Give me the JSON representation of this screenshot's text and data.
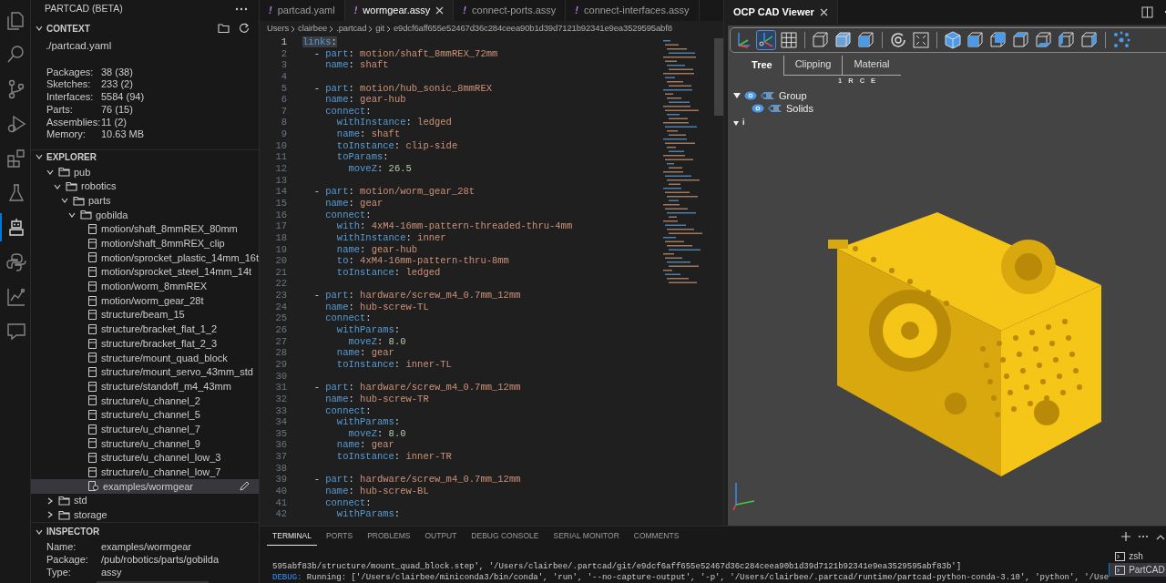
{
  "activity_bar": [
    {
      "kind": "files",
      "selected": false
    },
    {
      "kind": "search",
      "selected": false
    },
    {
      "kind": "source-control",
      "selected": false
    },
    {
      "kind": "run-debug",
      "selected": false
    },
    {
      "kind": "extensions",
      "selected": false
    },
    {
      "kind": "flask",
      "selected": false
    },
    {
      "kind": "robot",
      "selected": true
    },
    {
      "kind": "python",
      "selected": false
    },
    {
      "kind": "graph",
      "selected": false
    },
    {
      "kind": "comments",
      "selected": false
    }
  ],
  "sidebar": {
    "title": "PARTCAD (BETA)",
    "context": {
      "title": "CONTEXT",
      "expanded": true,
      "file": "./partcad.yaml",
      "stats": [
        {
          "label": "Packages:",
          "value": "38 (38)"
        },
        {
          "label": "Sketches:",
          "value": "233 (2)"
        },
        {
          "label": "Interfaces:",
          "value": "5584 (94)"
        },
        {
          "label": "Parts:",
          "value": "76 (15)"
        },
        {
          "label": "Assemblies:",
          "value": "11 (2)"
        },
        {
          "label": "Memory:",
          "value": "10.63 MB"
        }
      ]
    },
    "explorer": {
      "title": "EXPLORER",
      "expanded": true,
      "tree": [
        {
          "label": "pub",
          "kind": "folder",
          "expanded": true,
          "children": [
            {
              "label": "robotics",
              "kind": "folder",
              "expanded": true,
              "children": [
                {
                  "label": "parts",
                  "kind": "folder",
                  "expanded": true,
                  "children": [
                    {
                      "label": "gobilda",
                      "kind": "folder",
                      "expanded": true,
                      "children": [
                        {
                          "label": "motion/shaft_8mmREX_80mm",
                          "kind": "part",
                          "selected": false
                        },
                        {
                          "label": "motion/shaft_8mmREX_clip",
                          "kind": "part",
                          "selected": false
                        },
                        {
                          "label": "motion/sprocket_plastic_14mm_16t",
                          "kind": "part",
                          "selected": false
                        },
                        {
                          "label": "motion/sprocket_steel_14mm_14t",
                          "kind": "part",
                          "selected": false
                        },
                        {
                          "label": "motion/worm_8mmREX",
                          "kind": "part",
                          "selected": false
                        },
                        {
                          "label": "motion/worm_gear_28t",
                          "kind": "part",
                          "selected": false
                        },
                        {
                          "label": "structure/beam_15",
                          "kind": "part",
                          "selected": false
                        },
                        {
                          "label": "structure/bracket_flat_1_2",
                          "kind": "part",
                          "selected": false
                        },
                        {
                          "label": "structure/bracket_flat_2_3",
                          "kind": "part",
                          "selected": false
                        },
                        {
                          "label": "structure/mount_quad_block",
                          "kind": "part",
                          "selected": false
                        },
                        {
                          "label": "structure/mount_servo_43mm_std",
                          "kind": "part",
                          "selected": false
                        },
                        {
                          "label": "structure/standoff_m4_43mm",
                          "kind": "part",
                          "selected": false
                        },
                        {
                          "label": "structure/u_channel_2",
                          "kind": "part",
                          "selected": false
                        },
                        {
                          "label": "structure/u_channel_5",
                          "kind": "part",
                          "selected": false
                        },
                        {
                          "label": "structure/u_channel_7",
                          "kind": "part",
                          "selected": false
                        },
                        {
                          "label": "structure/u_channel_9",
                          "kind": "part",
                          "selected": false
                        },
                        {
                          "label": "structure/u_channel_low_3",
                          "kind": "part",
                          "selected": false
                        },
                        {
                          "label": "structure/u_channel_low_7",
                          "kind": "part",
                          "selected": false
                        },
                        {
                          "label": "examples/wormgear",
                          "kind": "assembly",
                          "selected": true
                        }
                      ]
                    }
                  ]
                }
              ]
            }
          ]
        },
        {
          "label": "std",
          "kind": "folder",
          "expanded": false
        },
        {
          "label": "storage",
          "kind": "folder",
          "expanded": false
        }
      ]
    },
    "inspector": {
      "title": "INSPECTOR",
      "expanded": true,
      "rows": [
        {
          "label": "Name:",
          "value": "examples/wormgear"
        },
        {
          "label": "Package:",
          "value": "/pub/robotics/parts/gobilda"
        },
        {
          "label": "Type:",
          "value": "assy"
        }
      ]
    }
  },
  "editor": {
    "tabs": [
      {
        "icon": "!",
        "label": "partcad.yaml",
        "selected": false
      },
      {
        "icon": "!",
        "label": "wormgear.assy",
        "selected": true
      },
      {
        "icon": "!",
        "label": "connect-ports.assy",
        "selected": false
      },
      {
        "icon": "!",
        "label": "connect-interfaces.assy",
        "selected": false
      }
    ],
    "breadcrumb": [
      "Users",
      "clairbee",
      ".partcad",
      "git",
      "e9dcf6aff655e52467d36c284ceea90b1d39d7121b92341e9ea3529595abf8"
    ],
    "lines": [
      {
        "n": "1",
        "text": "links:"
      },
      {
        "n": "2",
        "text": "  - part: motion/shaft_8mmREX_72mm"
      },
      {
        "n": "3",
        "text": "    name: shaft"
      },
      {
        "n": "4"
      },
      {
        "n": "5",
        "text": "  - part: motion/hub_sonic_8mmREX"
      },
      {
        "n": "6",
        "text": "    name: gear-hub"
      },
      {
        "n": "7",
        "text": "    connect:"
      },
      {
        "n": "8",
        "text": "      withInstance: ledged"
      },
      {
        "n": "9",
        "text": "      name: shaft"
      },
      {
        "n": "10",
        "text": "      toInstance: clip-side"
      },
      {
        "n": "11",
        "text": "      toParams:"
      },
      {
        "n": "12",
        "text": "        moveZ: 26.5"
      },
      {
        "n": "13"
      },
      {
        "n": "14",
        "text": "  - part: motion/worm_gear_28t"
      },
      {
        "n": "15",
        "text": "    name: gear"
      },
      {
        "n": "16",
        "text": "    connect:"
      },
      {
        "n": "17",
        "text": "      with: 4xM4-16mm-pattern-threaded-thru-4mm"
      },
      {
        "n": "18",
        "text": "      withInstance: inner"
      },
      {
        "n": "19",
        "text": "      name: gear-hub"
      },
      {
        "n": "20",
        "text": "      to: 4xM4-16mm-pattern-thru-8mm"
      },
      {
        "n": "21",
        "text": "      toInstance: ledged"
      },
      {
        "n": "22"
      },
      {
        "n": "23",
        "text": "  - part: hardware/screw_m4_0.7mm_12mm"
      },
      {
        "n": "24",
        "text": "    name: hub-screw-TL"
      },
      {
        "n": "25",
        "text": "    connect:"
      },
      {
        "n": "26",
        "text": "      withParams:"
      },
      {
        "n": "27",
        "text": "        moveZ: 8.0"
      },
      {
        "n": "28",
        "text": "      name: gear"
      },
      {
        "n": "29",
        "text": "      toInstance: inner-TL"
      },
      {
        "n": "30"
      },
      {
        "n": "31",
        "text": "  - part: hardware/screw_m4_0.7mm_12mm"
      },
      {
        "n": "32",
        "text": "    name: hub-screw-TR"
      },
      {
        "n": "33",
        "text": "    connect:"
      },
      {
        "n": "34",
        "text": "      withParams:"
      },
      {
        "n": "35",
        "text": "        moveZ: 8.0"
      },
      {
        "n": "36",
        "text": "      name: gear"
      },
      {
        "n": "37",
        "text": "      toInstance: inner-TR"
      },
      {
        "n": "38"
      },
      {
        "n": "39",
        "text": "  - part: hardware/screw_m4_0.7mm_12mm"
      },
      {
        "n": "40",
        "text": "    name: hub-screw-BL"
      },
      {
        "n": "41",
        "text": "    connect:"
      },
      {
        "n": "42",
        "text": "      withParams:"
      }
    ]
  },
  "viewer": {
    "title": "OCP CAD Viewer",
    "toolbar": [
      {
        "kind": "axes",
        "selected": false
      },
      {
        "kind": "axes-origin",
        "selected": true
      },
      {
        "kind": "grid",
        "selected": false
      },
      {
        "kind": "sep"
      },
      {
        "kind": "perspective",
        "selected": false
      },
      {
        "kind": "transparent",
        "selected": false
      },
      {
        "kind": "edges",
        "selected": false
      },
      {
        "kind": "sep"
      },
      {
        "kind": "reset",
        "selected": false
      },
      {
        "kind": "fit",
        "selected": false
      },
      {
        "kind": "sep"
      },
      {
        "kind": "iso",
        "selected": false
      },
      {
        "kind": "front",
        "selected": false
      },
      {
        "kind": "rear",
        "selected": false
      },
      {
        "kind": "top",
        "selected": false
      },
      {
        "kind": "bottom",
        "selected": false
      },
      {
        "kind": "left",
        "selected": false
      },
      {
        "kind": "right",
        "selected": false
      },
      {
        "kind": "sep"
      },
      {
        "kind": "explode",
        "selected": false
      }
    ],
    "tabs": [
      {
        "label": "Tree",
        "selected": true
      },
      {
        "label": "Clipping",
        "selected": false
      },
      {
        "label": "Material",
        "selected": false
      }
    ],
    "shortcuts": [
      "1",
      "R",
      "C",
      "E"
    ],
    "tree": [
      {
        "label": "Group",
        "expanded": true,
        "visible": true,
        "children": [
          {
            "label": "Solids",
            "visible": true
          }
        ]
      }
    ],
    "info": {
      "label": "i",
      "expanded": true
    }
  },
  "panel": {
    "tabs": [
      {
        "label": "TERMINAL",
        "selected": true
      },
      {
        "label": "PORTS",
        "selected": false
      },
      {
        "label": "PROBLEMS",
        "selected": false
      },
      {
        "label": "OUTPUT",
        "selected": false
      },
      {
        "label": "DEBUG CONSOLE",
        "selected": false
      },
      {
        "label": "SERIAL MONITOR",
        "selected": false
      },
      {
        "label": "COMMENTS",
        "selected": false
      }
    ],
    "output": [
      {
        "kind": "plain",
        "text": "595abf83b/structure/mount_quad_block.step', '/Users/clairbee/.partcad/git/e9dcf6aff655e52467d36c284ceea90b1d39d7121b92341e9ea3529595abf83b']"
      },
      {
        "kind": "debug",
        "prefix": "DEBUG:",
        "text": " Running: ['/Users/clairbee/miniconda3/bin/conda', 'run', '--no-capture-output', '-p', '/Users/clairbee/.partcad/runtime/partcad-python-conda-3.10', 'python', '/Use"
      }
    ],
    "terminals": [
      {
        "label": "zsh",
        "selected": false
      },
      {
        "label": "PartCAD",
        "selected": true
      }
    ]
  }
}
